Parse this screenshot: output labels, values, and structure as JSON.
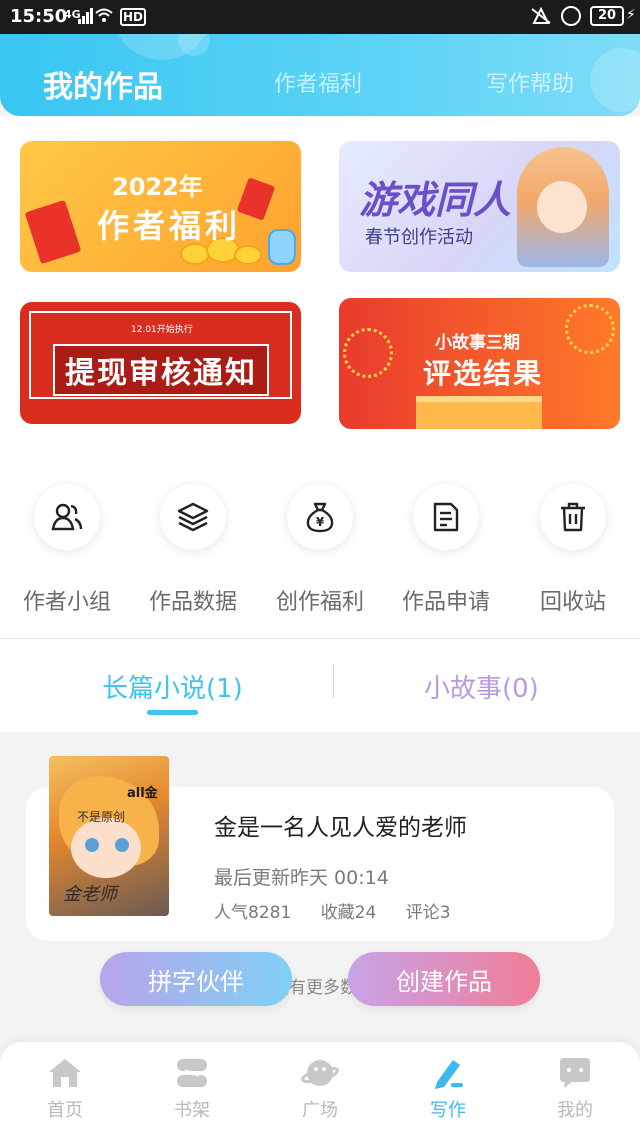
{
  "status_bar": {
    "time": "15:50",
    "network": "4G",
    "hd": "HD",
    "battery": "20"
  },
  "header": {
    "tabs": [
      {
        "label": "我的作品",
        "active": true
      },
      {
        "label": "作者福利",
        "active": false
      },
      {
        "label": "写作帮助",
        "active": false
      }
    ],
    "accent_color": "#38c6f2"
  },
  "banners": {
    "welfare": {
      "line1": "2022年",
      "line2": "作者福利"
    },
    "game": {
      "line1": "游戏同人",
      "line2": "春节创作活动"
    },
    "withdraw": {
      "small": "12.01开始执行",
      "title": "提现审核通知"
    },
    "story": {
      "line1": "小故事三期",
      "line2": "评选结果"
    }
  },
  "tools": [
    {
      "label": "作者小组",
      "icon": "users-icon"
    },
    {
      "label": "作品数据",
      "icon": "layers-icon"
    },
    {
      "label": "创作福利",
      "icon": "money-bag-icon"
    },
    {
      "label": "作品申请",
      "icon": "document-icon"
    },
    {
      "label": "回收站",
      "icon": "trash-icon"
    }
  ],
  "work_tabs": [
    {
      "label": "长篇小说(1)",
      "active": true
    },
    {
      "label": "小故事(0)",
      "active": false
    }
  ],
  "work": {
    "title": "金是一名人见人爱的老师",
    "last_update": "最后更新昨天 00:14",
    "popularity": "人气8281",
    "favorites": "收藏24",
    "comments": "评论3",
    "cover_brand": "all金",
    "cover_sub": "不是原创",
    "cover_name": "金老师"
  },
  "no_more_text": "没有更多数",
  "actions": {
    "partner": "拼字伙伴",
    "create": "创建作品"
  },
  "bottom_nav": [
    {
      "label": "首页",
      "icon": "home-icon",
      "active": false
    },
    {
      "label": "书架",
      "icon": "bookshelf-icon",
      "active": false
    },
    {
      "label": "广场",
      "icon": "planet-icon",
      "active": false
    },
    {
      "label": "写作",
      "icon": "pen-icon",
      "active": true
    },
    {
      "label": "我的",
      "icon": "chat-bubble-icon",
      "active": false
    }
  ]
}
